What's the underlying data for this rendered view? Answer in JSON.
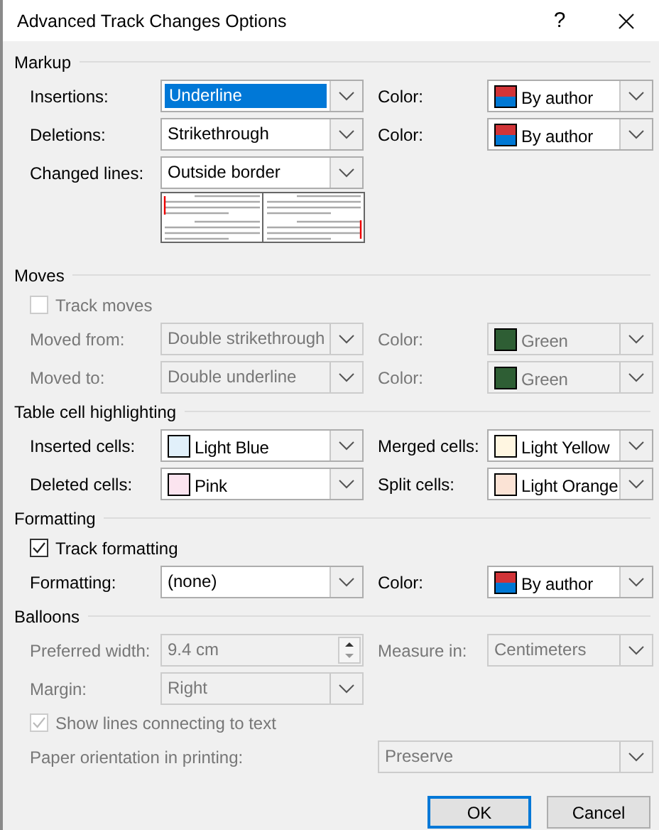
{
  "window": {
    "title": "Advanced Track Changes Options",
    "help": "?"
  },
  "sections": [
    {
      "title": "Markup",
      "rows": [
        {
          "kind": "fields",
          "fields": [
            {
              "label": "Insertions:",
              "kind": "select",
              "value": "Underline",
              "focused": true,
              "disabled": false
            },
            {
              "label": "Color:",
              "kind": "color",
              "value": "By author",
              "disabled": false
            }
          ]
        },
        {
          "kind": "fields",
          "fields": [
            {
              "label": "Deletions:",
              "kind": "select",
              "value": "Strikethrough",
              "focused": false,
              "disabled": false
            },
            {
              "label": "Color:",
              "kind": "color",
              "value": "By author",
              "disabled": false
            }
          ]
        },
        {
          "kind": "fields",
          "fields": [
            {
              "label": "Changed lines:",
              "kind": "select",
              "value": "Outside border",
              "focused": false,
              "disabled": false
            }
          ]
        },
        {
          "kind": "preview"
        }
      ]
    },
    {
      "title": "Moves",
      "rows": [
        {
          "kind": "check",
          "label": "Track moves",
          "checked": false,
          "disabled": true
        },
        {
          "kind": "fields",
          "fields": [
            {
              "label": "Moved from:",
              "kind": "select",
              "value": "Double strikethrough",
              "focused": false,
              "disabled": true
            },
            {
              "label": "Color:",
              "kind": "color",
              "value": "Green",
              "color": "#2e5e34",
              "disabled": true
            }
          ]
        },
        {
          "kind": "fields",
          "fields": [
            {
              "label": "Moved to:",
              "kind": "select",
              "value": "Double underline",
              "focused": false,
              "disabled": true
            },
            {
              "label": "Color:",
              "kind": "color",
              "value": "Green",
              "color": "#2e5e34",
              "disabled": true
            }
          ]
        }
      ]
    },
    {
      "title": "Table cell highlighting",
      "rows": [
        {
          "kind": "fields",
          "fields": [
            {
              "label": "Inserted cells:",
              "kind": "color",
              "value": "Light Blue",
              "color": "#e1f0fa",
              "disabled": false
            },
            {
              "label": "Merged cells:",
              "kind": "color",
              "value": "Light Yellow",
              "color": "#fff6e1",
              "disabled": false
            }
          ]
        },
        {
          "kind": "fields",
          "fields": [
            {
              "label": "Deleted cells:",
              "kind": "color",
              "value": "Pink",
              "color": "#fbe4ef",
              "disabled": false
            },
            {
              "label": "Split cells:",
              "kind": "color",
              "value": "Light Orange",
              "color": "#fbe3d5",
              "disabled": false
            }
          ]
        }
      ]
    },
    {
      "title": "Formatting",
      "rows": [
        {
          "kind": "check",
          "label": "Track formatting",
          "checked": true,
          "disabled": false
        },
        {
          "kind": "fields",
          "fields": [
            {
              "label": "Formatting:",
              "kind": "select",
              "value": "(none)",
              "focused": false,
              "disabled": false
            },
            {
              "label": "Color:",
              "kind": "color",
              "value": "By author",
              "disabled": false
            }
          ]
        }
      ]
    },
    {
      "title": "Balloons",
      "rows": [
        {
          "kind": "fields",
          "fields": [
            {
              "label": "Preferred width:",
              "kind": "spin",
              "value": "9.4 cm",
              "disabled": true
            },
            {
              "label": "Measure in:",
              "kind": "select",
              "value": "Centimeters",
              "focused": false,
              "disabled": true
            }
          ]
        },
        {
          "kind": "fields",
          "fields": [
            {
              "label": "Margin:",
              "kind": "select",
              "value": "Right",
              "focused": false,
              "disabled": true
            }
          ]
        },
        {
          "kind": "check",
          "label": "Show lines connecting to text",
          "checked": true,
          "disabled": true
        },
        {
          "kind": "wide",
          "fields": [
            {
              "label": "Paper orientation in printing:",
              "kind": "select",
              "value": "Preserve",
              "focused": false,
              "disabled": true
            }
          ]
        }
      ]
    }
  ],
  "buttons": [
    {
      "label": "OK",
      "default": true
    },
    {
      "label": "Cancel",
      "default": false
    }
  ]
}
